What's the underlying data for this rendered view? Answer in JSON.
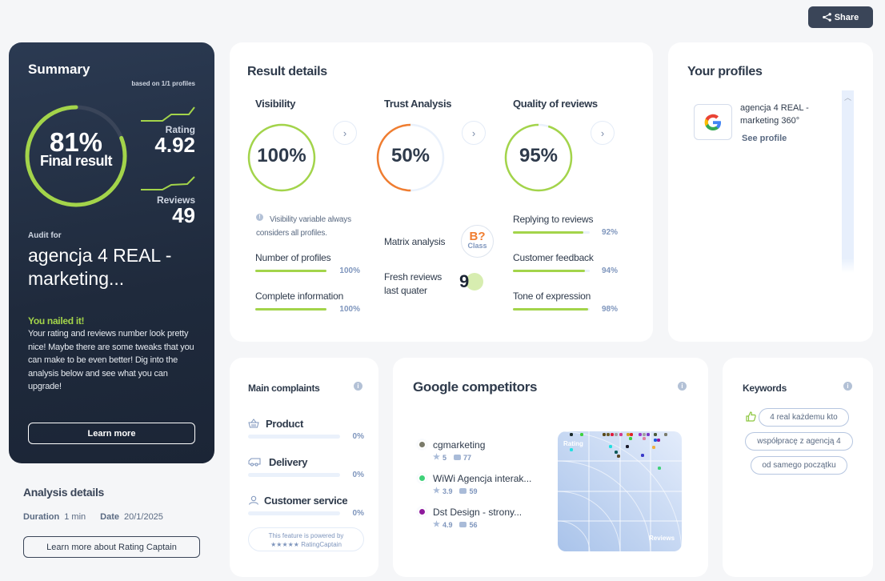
{
  "share": {
    "label": "Share"
  },
  "summary": {
    "title": "Summary",
    "based_on": "based on 1/1 profiles",
    "final_pct": "81%",
    "final_value": 81,
    "final_label": "Final result",
    "rating_label": "Rating",
    "rating_value": "4.92",
    "reviews_label": "Reviews",
    "reviews_value": "49",
    "audit_for": "Audit for",
    "company": "agencja 4 REAL - marketing...",
    "headline": "You nailed it!",
    "description": "Your rating and reviews number look pretty nice! Maybe there are some tweaks that you can make to be even better! Dig into the analysis below and see what you can upgrade!",
    "learn_more": "Learn more",
    "colors": {
      "accent": "#a3d44a"
    }
  },
  "analysis": {
    "title": "Analysis details",
    "duration_label": "Duration",
    "duration_value": "1 min",
    "date_label": "Date",
    "date_value": "20/1/2025",
    "button": "Learn more about Rating Captain"
  },
  "result": {
    "title": "Result details",
    "visibility": {
      "title": "Visibility",
      "pct": "100%",
      "value": 100,
      "color": "#a3d44a",
      "note": "Visibility variable always considers all profiles.",
      "metrics": [
        {
          "label": "Number of profiles",
          "pct": "100%",
          "value": 100
        },
        {
          "label": "Complete information",
          "pct": "100%",
          "value": 100
        }
      ]
    },
    "trust": {
      "title": "Trust Analysis",
      "pct": "50%",
      "value": 50,
      "color": "#f07d30",
      "matrix_label": "Matrix analysis",
      "class_value": "B?",
      "class_label": "Class",
      "fresh_label": "Fresh reviews last quater",
      "fresh_value": "9"
    },
    "quality": {
      "title": "Quality of reviews",
      "pct": "95%",
      "value": 95,
      "color": "#a3d44a",
      "metrics": [
        {
          "label": "Replying to reviews",
          "pct": "92%",
          "value": 92
        },
        {
          "label": "Customer feedback",
          "pct": "94%",
          "value": 94
        },
        {
          "label": "Tone of expression",
          "pct": "98%",
          "value": 98
        }
      ]
    }
  },
  "profiles": {
    "title": "Your profiles",
    "items": [
      {
        "platform": "google-icon",
        "name": "agencja 4 REAL - marketing 360°",
        "link": "See profile"
      }
    ]
  },
  "complaints": {
    "title": "Main complaints",
    "items": [
      {
        "label": "Product",
        "icon": "basket-icon",
        "pct": "0%",
        "value": 0
      },
      {
        "label": "Delivery",
        "icon": "truck-icon",
        "pct": "0%",
        "value": 0
      },
      {
        "label": "Customer service",
        "icon": "user-icon",
        "pct": "0%",
        "value": 0
      }
    ],
    "powered_line1": "This feature is powered by",
    "powered_line2": "★★★★★ RatingCaptain"
  },
  "competitors": {
    "title": "Google competitors",
    "items": [
      {
        "name": "cgmarketing",
        "rating": "5",
        "reviews": "77",
        "color": "#7a7a6a"
      },
      {
        "name": "WiWi Agencja interak...",
        "rating": "3.9",
        "reviews": "59",
        "color": "#3ed178"
      },
      {
        "name": "Dst Design - strony...",
        "rating": "4.9",
        "reviews": "56",
        "color": "#8e1a9c"
      }
    ],
    "plot": {
      "x_label": "Reviews",
      "y_label": "Rating"
    }
  },
  "keywords": {
    "title": "Keywords",
    "items": [
      "4 real każdemu kto",
      "współpracę z agencją 4",
      "od samego początku"
    ]
  }
}
